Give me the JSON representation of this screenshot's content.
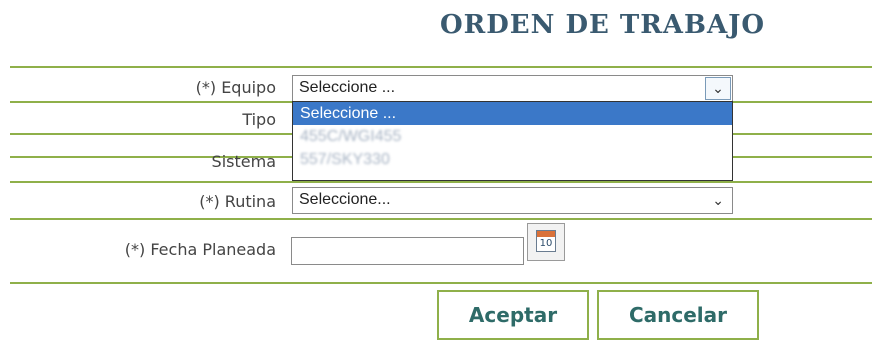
{
  "title": "ORDEN DE TRABAJO",
  "form": {
    "equipo": {
      "label": "(*) Equipo",
      "value": "Seleccione ...",
      "options": [
        "Seleccione ...",
        "455C/WGI455",
        "557/SKY330"
      ]
    },
    "tipo": {
      "label": "Tipo"
    },
    "sistema": {
      "label": "Sistema"
    },
    "rutina": {
      "label": "(*) Rutina",
      "value": "Seleccione..."
    },
    "fecha": {
      "label": "(*) Fecha Planeada",
      "value": "",
      "calendar_day": "10"
    }
  },
  "actions": {
    "accept_label": "Aceptar",
    "cancel_label": "Cancelar"
  },
  "colors": {
    "accent_line": "#8fb04a",
    "title": "#3a5a70",
    "highlight": "#3b78c8",
    "button_text": "#2e6b68"
  },
  "icons": {
    "chevron": "chevron-down-icon",
    "calendar": "calendar-icon"
  }
}
